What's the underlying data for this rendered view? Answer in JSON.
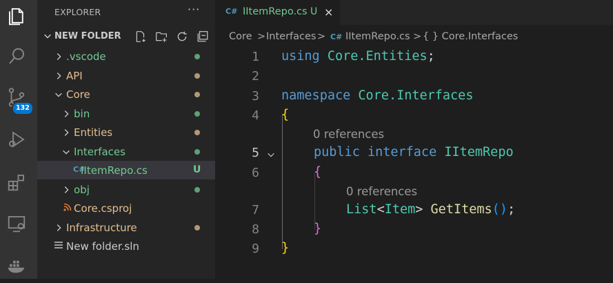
{
  "colors": {
    "accent": "#0078d4",
    "git_untracked": "#73c991",
    "git_modified": "#e2c08d",
    "folder_ignored": "#8c8c8c"
  },
  "activity_bar": {
    "items": [
      {
        "name": "explorer",
        "icon": "files-icon"
      },
      {
        "name": "search",
        "icon": "search-icon"
      },
      {
        "name": "source-control",
        "icon": "source-control-icon",
        "badge": "132"
      },
      {
        "name": "run-debug",
        "icon": "run-debug-icon"
      },
      {
        "name": "extensions",
        "icon": "extensions-icon"
      },
      {
        "name": "remote-explorer",
        "icon": "remote-explorer-icon"
      },
      {
        "name": "docker",
        "icon": "docker-icon"
      }
    ]
  },
  "sidebar": {
    "title": "EXPLORER",
    "more": "···",
    "folder_name": "NEW FOLDER",
    "header_actions": [
      "new-file-icon",
      "new-folder-icon",
      "refresh-icon",
      "collapse-all-icon"
    ],
    "tree": [
      {
        "label": ".vscode",
        "type": "folder",
        "expanded": false,
        "depth": 0,
        "color": "#73c991",
        "dot": "#73c991"
      },
      {
        "label": "API",
        "type": "folder",
        "expanded": false,
        "depth": 0,
        "color": "#e2c08d",
        "dot": "#e2c08d"
      },
      {
        "label": "Core",
        "type": "folder",
        "expanded": true,
        "depth": 0,
        "color": "#e2c08d",
        "dot": "#e2c08d"
      },
      {
        "label": "bin",
        "type": "folder",
        "expanded": false,
        "depth": 1,
        "color": "#73c991",
        "dot": "#73c991"
      },
      {
        "label": "Entities",
        "type": "folder",
        "expanded": false,
        "depth": 1,
        "color": "#e2c08d",
        "dot": "#e2c08d"
      },
      {
        "label": "Interfaces",
        "type": "folder",
        "expanded": true,
        "depth": 1,
        "color": "#73c991",
        "dot": "#73c991"
      },
      {
        "label": "IItemRepo.cs",
        "type": "file",
        "depth": 2,
        "color": "#73c991",
        "status": "U",
        "icon": "csharp-file-icon",
        "selected": true
      },
      {
        "label": "obj",
        "type": "folder",
        "expanded": false,
        "depth": 1,
        "color": "#73c991",
        "dot": "#73c991"
      },
      {
        "label": "Core.csproj",
        "type": "file",
        "depth": 1,
        "color": "#e2c08d",
        "icon": "rss-file-icon"
      },
      {
        "label": "Infrastructure",
        "type": "folder",
        "expanded": false,
        "depth": 0,
        "color": "#e2c08d",
        "dot": "#e2c08d"
      },
      {
        "label": "New folder.sln",
        "type": "file",
        "depth": 0,
        "color": "#cccccc",
        "icon": "lines-file-icon"
      }
    ]
  },
  "tab": {
    "icon": "C#",
    "title": "IItemRepo.cs",
    "status": "U",
    "close": "×"
  },
  "breadcrumb": {
    "items": [
      "Core",
      ">",
      "Interfaces",
      ">",
      "IItemRepo.cs",
      ">",
      "{ } Core.Interfaces"
    ]
  },
  "editor": {
    "line_numbers": [
      "1",
      "2",
      "3",
      "4",
      "5",
      "6",
      "7",
      "8",
      "9"
    ],
    "active_line": "5",
    "references_label": "0 references",
    "tokens": {
      "l1": [
        "using",
        " ",
        "Core.Entities",
        ";"
      ],
      "l3": [
        "namespace",
        " ",
        "Core.Interfaces"
      ],
      "l4": [
        "{"
      ],
      "l5": [
        "public",
        " ",
        "interface",
        " ",
        "IItemRepo"
      ],
      "l6": [
        "{"
      ],
      "l7": [
        "List",
        "<",
        "Item",
        "> ",
        "GetItems",
        "(",
        ")",
        ";"
      ],
      "l8": [
        "}"
      ],
      "l9": [
        "}"
      ]
    }
  }
}
